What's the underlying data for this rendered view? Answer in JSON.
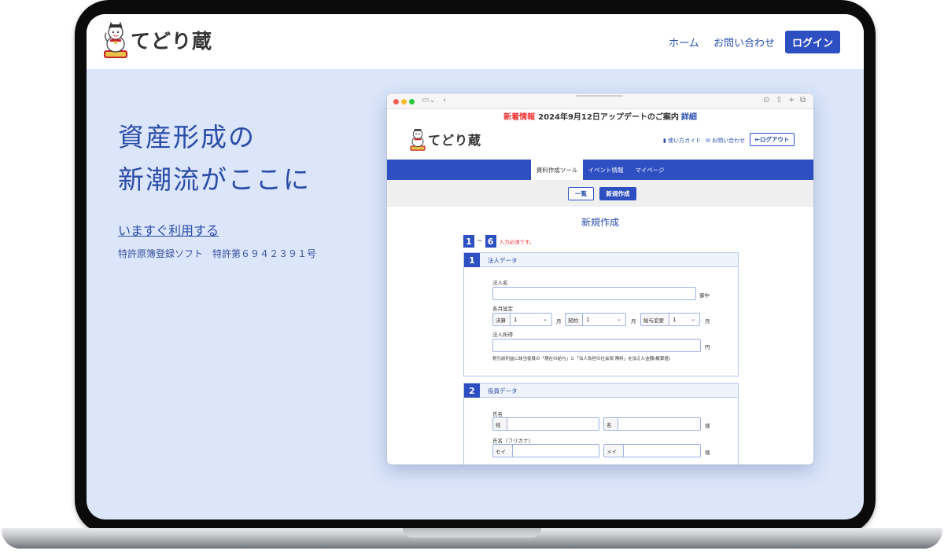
{
  "site": {
    "logo_text": "てどり蔵",
    "nav": {
      "home": "ホーム",
      "contact": "お問い合わせ",
      "login": "ログイン"
    }
  },
  "hero": {
    "heading_line1": "資産形成の",
    "heading_line2": "新潮流がここに",
    "cta": "いますぐ利用する",
    "patent": "特許原簿登録ソフト　特許第６９４２３９１号"
  },
  "colors": {
    "primary": "#2d4fc1",
    "hero_bg": "#dbe6fa",
    "heading": "#2a4ba8",
    "alert": "#e33333"
  },
  "mockup": {
    "news": {
      "label": "新着情報",
      "title": "2024年9月12日アップデートのご案内",
      "link": "詳細"
    },
    "logo_text": "てどり蔵",
    "header_links": {
      "guide": "使い方ガイド",
      "contact": "お問い合わせ",
      "logout": "ログアウト"
    },
    "tabs": [
      {
        "label": "資料作成ツール",
        "active": true
      },
      {
        "label": "イベント情報",
        "active": false
      },
      {
        "label": "マイページ",
        "active": false
      }
    ],
    "buttons": {
      "list": "一覧",
      "new": "新規作成"
    },
    "page_title": "新規作成",
    "steps": {
      "first": "1",
      "separator": "~",
      "last": "6",
      "required_note": "入力必須です。"
    },
    "section1": {
      "num": "1",
      "title": "法人データ",
      "company_name_label": "法人名",
      "company_name_suffix": "御中",
      "month_label": "各月設定",
      "months": [
        {
          "addon": "決算",
          "value": "1",
          "unit": "月"
        },
        {
          "addon": "契約",
          "value": "1",
          "unit": "月"
        },
        {
          "addon": "給与変更",
          "value": "1",
          "unit": "月"
        }
      ],
      "income_label": "法人所得",
      "income_unit": "円",
      "income_note": "税引前利益に該当役員の「現在の給与」と「法人負担の社会保 険料」を加えた金額(概算値)"
    },
    "section2": {
      "num": "2",
      "title": "役員データ",
      "name_label": "氏名",
      "last_name_addon": "姓",
      "first_name_addon": "名",
      "honorific": "様",
      "kana_label": "氏名（フリガナ）",
      "sei_addon": "セイ",
      "mei_addon": "メイ",
      "kana_honorific": "様"
    }
  }
}
